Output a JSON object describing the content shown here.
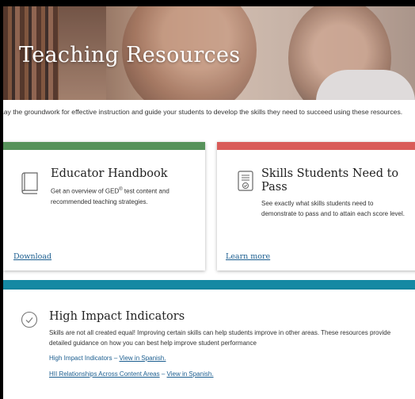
{
  "hero": {
    "title": "Teaching Resources"
  },
  "intro": "Lay the groundwork for effective instruction and guide your students to develop the skills they need to succeed using these resources.",
  "cards": [
    {
      "icon": "book-icon",
      "title": "Educator Handbook",
      "desc_before": "Get an overview of GED",
      "desc_sup": "®",
      "desc_after": " test content and recommended teaching strategies.",
      "link": "Download",
      "color": "#56925a"
    },
    {
      "icon": "checklist-icon",
      "title": "Skills Students Need to Pass",
      "desc": "See exactly what skills students need to demonstrate to pass and to attain each score level.",
      "link": "Learn more",
      "color": "#d95c59"
    }
  ],
  "section": {
    "icon": "check-circle-icon",
    "title": "High Impact Indicators",
    "desc": "Skills are not all created equal! Improving certain skills can help students improve in other areas. These resources provide detailed guidance on how you can best help improve student performance",
    "color": "#1589a3",
    "links": [
      {
        "label": "High Impact Indicators",
        "sep": " – ",
        "alt": "View in Spanish."
      },
      {
        "label": "HII Relationships Across Content Areas",
        "sep": " – ",
        "alt": "View in Spanish."
      }
    ]
  }
}
